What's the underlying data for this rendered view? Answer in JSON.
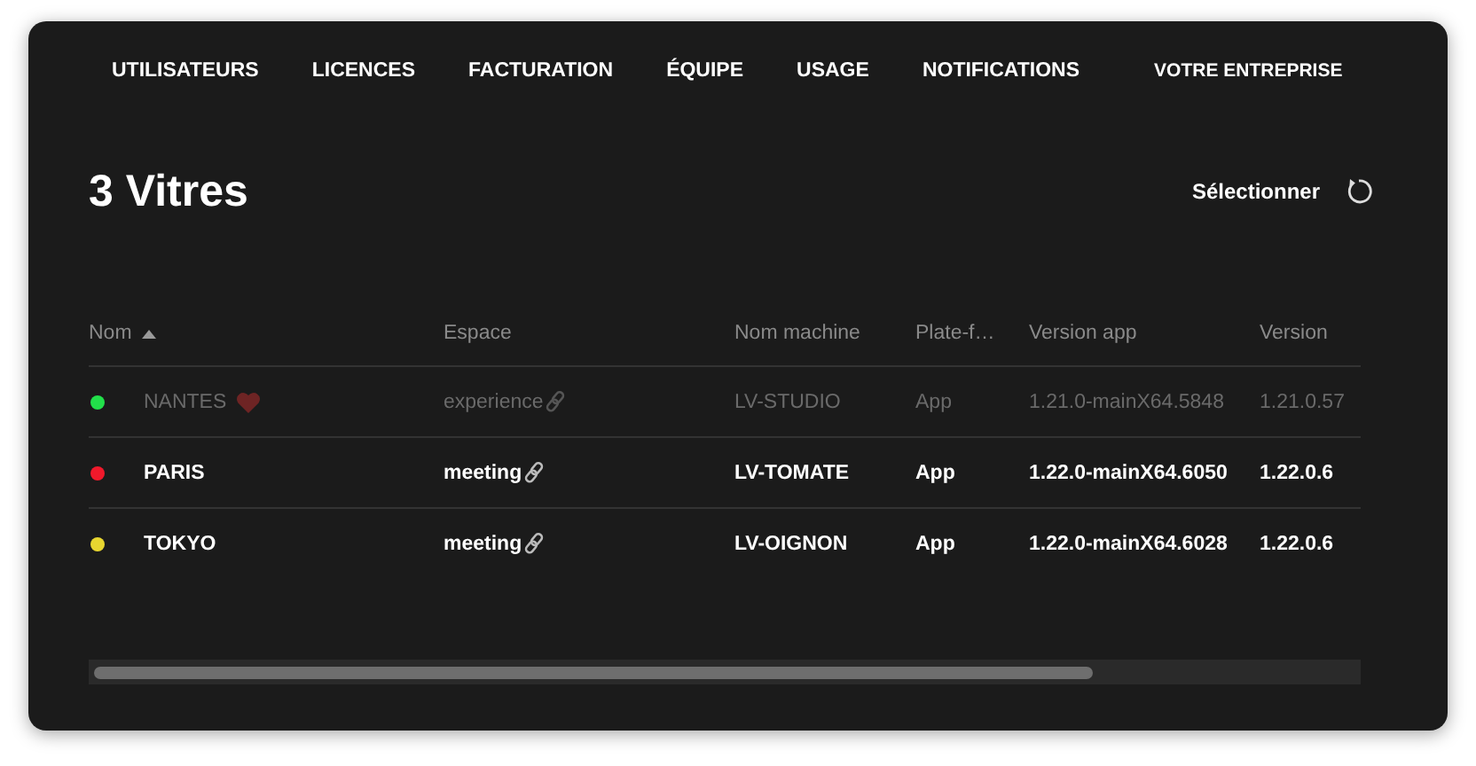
{
  "tabs": [
    {
      "label": "UTILISATEURS"
    },
    {
      "label": "LICENCES"
    },
    {
      "label": "FACTURATION"
    },
    {
      "label": "ÉQUIPE"
    },
    {
      "label": "USAGE"
    },
    {
      "label": "NOTIFICATIONS"
    },
    {
      "label": "VOTRE ENTREPRISE",
      "kind": "company"
    }
  ],
  "title": "3 Vitres",
  "select_button": "Sélectionner",
  "table": {
    "columns": [
      {
        "label": "Nom",
        "sorted": true
      },
      {
        "label": "Espace"
      },
      {
        "label": "Nom machine"
      },
      {
        "label": "Plate-f…"
      },
      {
        "label": "Version app"
      },
      {
        "label": "Version"
      }
    ],
    "rows": [
      {
        "color": "#22e04a",
        "name": "NANTES",
        "favorite": true,
        "disabled": true,
        "space": "experience",
        "machine": "LV-STUDIO",
        "platform": "App",
        "version_app": "1.21.0-mainX64.5848",
        "column_6": "1.21.0.57"
      },
      {
        "color": "#f0192b",
        "name": "PARIS",
        "favorite": false,
        "disabled": false,
        "space": "meeting",
        "machine": "LV-TOMATE",
        "platform": "App",
        "version_app": "1.22.0-mainX64.6050",
        "column_6": "1.22.0.6"
      },
      {
        "color": "#e8d630",
        "name": "TOKYO",
        "favorite": false,
        "disabled": false,
        "space": "meeting",
        "machine": "LV-OIGNON",
        "platform": "App",
        "version_app": "1.22.0-mainX64.6028",
        "column_6": "1.22.0.6"
      }
    ]
  }
}
